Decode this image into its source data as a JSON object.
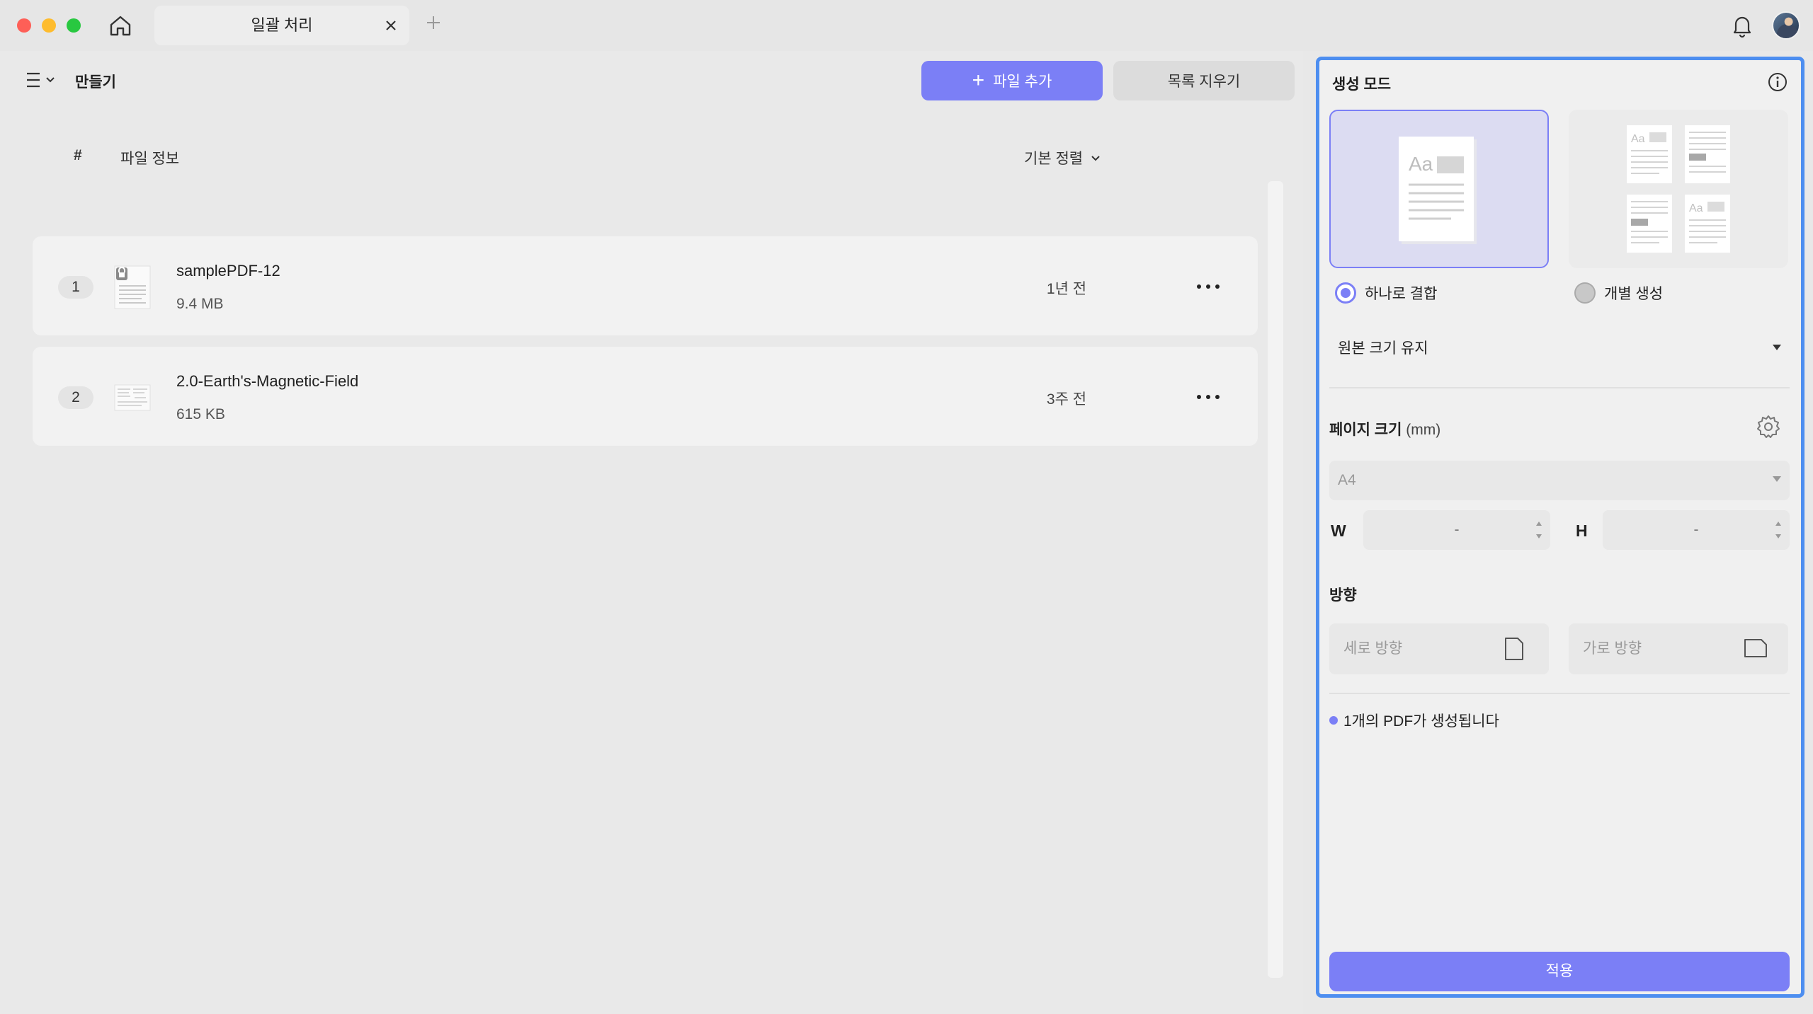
{
  "tab": {
    "label": "일괄 처리"
  },
  "toolbar": {
    "create_label": "만들기",
    "add_file_label": "파일 추가",
    "clear_list_label": "목록 지우기"
  },
  "list": {
    "col_hash": "#",
    "col_info": "파일 정보",
    "sort_label": "기본 정렬",
    "files": [
      {
        "num": "1",
        "name": "samplePDF-12",
        "size": "9.4 MB",
        "time": "1년 전",
        "locked": true
      },
      {
        "num": "2",
        "name": "2.0-Earth's-Magnetic-Field",
        "size": "615 KB",
        "time": "3주 전",
        "locked": false
      }
    ]
  },
  "panel": {
    "title": "생성 모드",
    "mode_combine": "하나로 결합",
    "mode_separate": "개별 생성",
    "size_select": "원본 크기 유지",
    "page_size_label": "페이지 크기",
    "page_size_unit": "(mm)",
    "paper_select": "A4",
    "w_label": "W",
    "h_label": "H",
    "w_value": "-",
    "h_value": "-",
    "orientation_label": "방향",
    "portrait_label": "세로 방향",
    "landscape_label": "가로 방향",
    "status_text": "1개의 PDF가 생성됩니다",
    "apply_label": "적용"
  },
  "colors": {
    "accent": "#7b7ff6",
    "panel_border": "#4d8ef0"
  },
  "icons": [
    "home-icon",
    "close-icon",
    "plus-icon",
    "bell-icon",
    "menu-icon",
    "chevron-down-icon",
    "lock-icon",
    "more-icon",
    "info-icon",
    "gear-icon",
    "portrait-icon",
    "landscape-icon"
  ]
}
